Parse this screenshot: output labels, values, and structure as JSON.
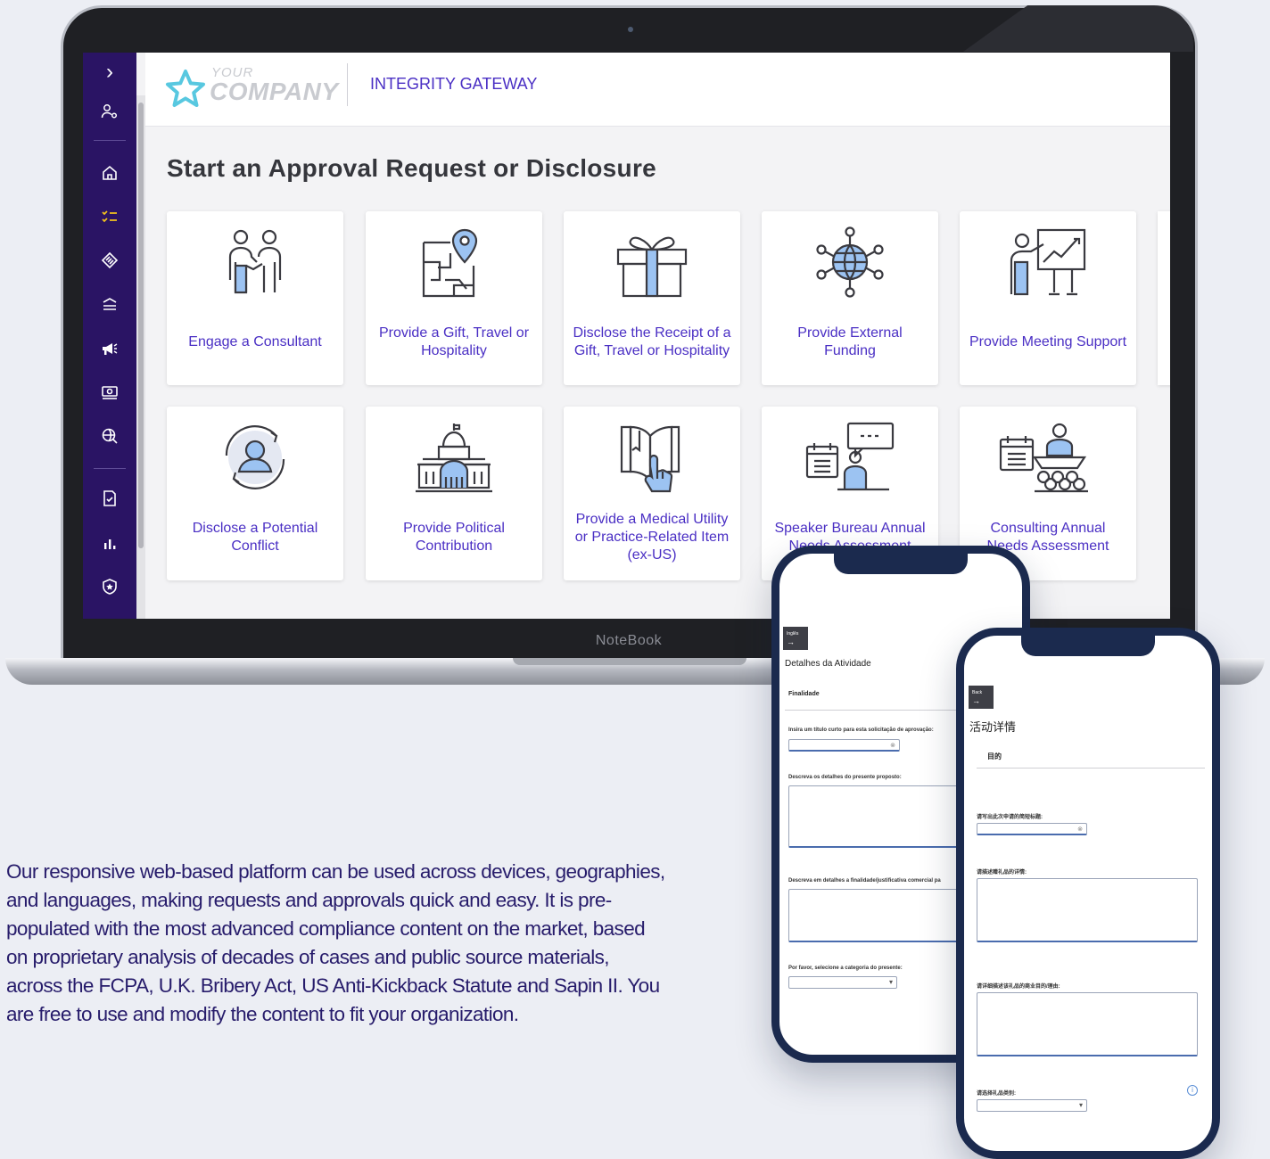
{
  "laptop": {
    "brand_label": "NoteBook"
  },
  "logo": {
    "top": "YOUR",
    "bottom": "COMPANY"
  },
  "header": {
    "app_title": "INTEGRITY GATEWAY"
  },
  "main": {
    "page_title": "Start an Approval Request or Disclosure"
  },
  "sidebar": {
    "icons": [
      {
        "name": "expand-chevron-icon",
        "glyph": "›"
      },
      {
        "name": "user-settings-icon",
        "glyph": "⚙"
      },
      {
        "name": "home-icon",
        "glyph": "⌂"
      },
      {
        "name": "checklist-icon",
        "glyph": "☰"
      },
      {
        "name": "handshake-icon",
        "glyph": "◈"
      },
      {
        "name": "layers-icon",
        "glyph": "≅"
      },
      {
        "name": "megaphone-icon",
        "glyph": "📢"
      },
      {
        "name": "money-icon",
        "glyph": "▣"
      },
      {
        "name": "search-globe-icon",
        "glyph": "⊕"
      },
      {
        "name": "document-check-icon",
        "glyph": "☑"
      },
      {
        "name": "bar-chart-icon",
        "glyph": "ıl"
      },
      {
        "name": "shield-star-icon",
        "glyph": "✪"
      }
    ],
    "accent": "#f2c21c"
  },
  "cards": [
    {
      "label": "Engage a Consultant",
      "icon": "consultant-handshake-icon"
    },
    {
      "label": "Provide a Gift, Travel or Hospitality",
      "icon": "map-pin-icon"
    },
    {
      "label": "Disclose the Receipt of a Gift, Travel or Hospitality",
      "icon": "gift-box-icon"
    },
    {
      "label": "Provide External Funding",
      "icon": "globe-network-icon"
    },
    {
      "label": "Provide Meeting Support",
      "icon": "presentation-icon"
    },
    {
      "label": "Disclose a Potential Conflict",
      "icon": "user-cycle-icon"
    },
    {
      "label": "Provide Political Contribution",
      "icon": "capitol-building-icon"
    },
    {
      "label": "Provide a Medical Utility or Practice-Related Item (ex-US)",
      "icon": "book-hand-icon"
    },
    {
      "label": "Speaker Bureau Annual Needs Assessment",
      "icon": "speaker-chat-icon"
    },
    {
      "label": "Consulting Annual Needs Assessment",
      "icon": "audience-calendar-icon"
    }
  ],
  "phone_pt": {
    "back_label": "Inglês",
    "title": "Detalhes da Atividade",
    "section": "Finalidade",
    "q1": "Insira um título curto para esta solicitação de aprovação:",
    "q2": "Descreva os detalhes do presente proposto:",
    "q3": "Descreva em detalhes a finalidade/justificativa comercial pa",
    "q4": "Por favor, selecione a categoria do presente:"
  },
  "phone_zh": {
    "back_label": "Back",
    "title": "活动详情",
    "section": "目的",
    "q1": "请写出此次申请的简短标题:",
    "q2": "请描述赠礼品的详情:",
    "q3": "请详细描述该礼品的商业目的/理由:",
    "q4": "请选择礼品类别:"
  },
  "description": "Our responsive web-based platform can be used across devices, geographies, and languages, making requests and approvals quick and easy. It is pre-populated with the most advanced compliance content on the market, based on proprietary analysis of decades of cases and public source materials, across the FCPA, U.K. Bribery Act, US Anti-Kickback Statute and Sapin II. You are free to use and modify the content to fit your organization.",
  "colors": {
    "brand_purple": "#4a2fc4",
    "sidebar": "#2a1464",
    "text_navy": "#271c6b",
    "icon_blue": "#9cc3f2"
  }
}
